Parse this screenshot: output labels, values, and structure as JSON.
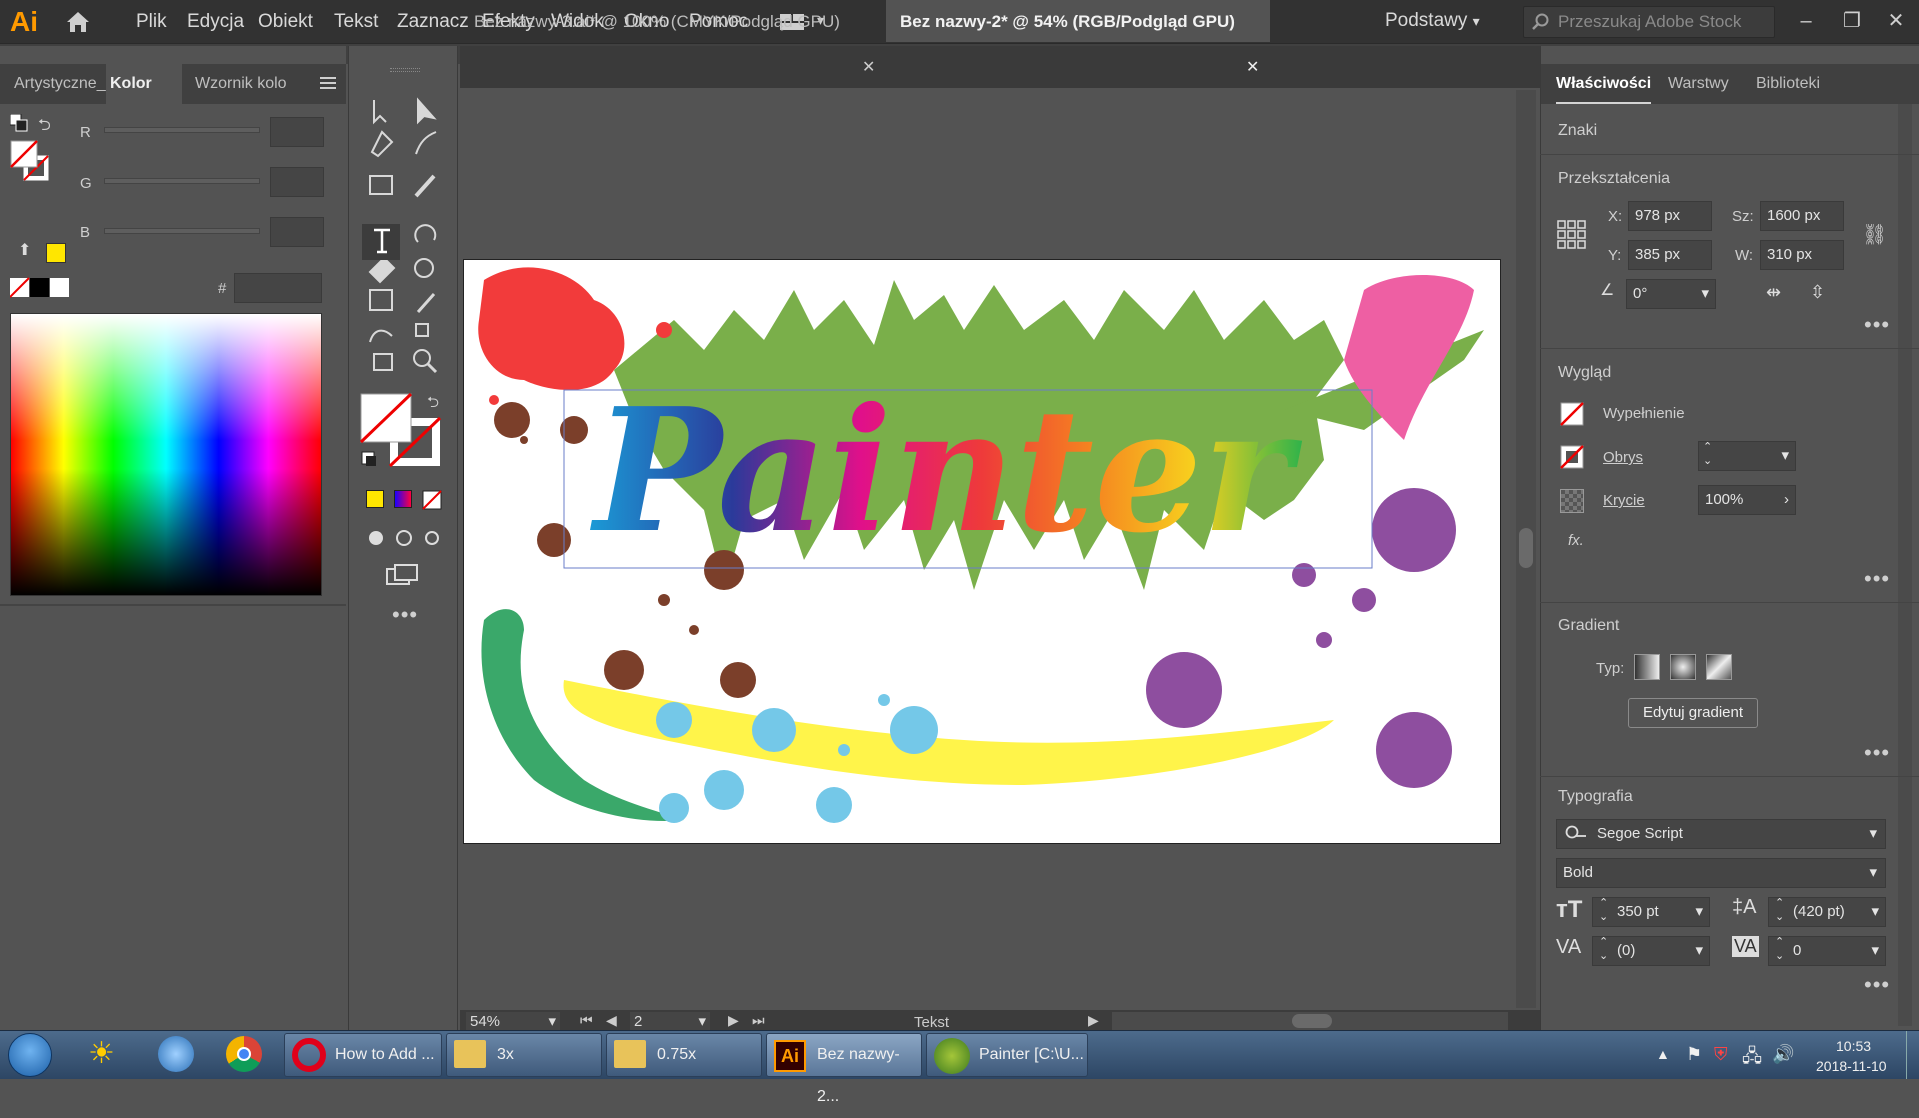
{
  "app": {
    "logo": "Ai"
  },
  "menu": [
    "Plik",
    "Edycja",
    "Obiekt",
    "Tekst",
    "Zaznacz",
    "Efekty",
    "Widok",
    "Okno",
    "Pomoc"
  ],
  "workspace": "Podstawy",
  "search_placeholder": "Przeszukaj Adobe Stock",
  "left_panel": {
    "tabs": [
      "Artystyczne_",
      "Kolor",
      "Wzornik kolo"
    ],
    "sliders": [
      "R",
      "G",
      "B"
    ],
    "hex_label": "#",
    "active_tab": "Kolor"
  },
  "doc_tabs": [
    {
      "label": "Bez nazwy-3.ai* @ 100% (CMYK/Podgląd GPU)",
      "active": false
    },
    {
      "label": "Bez nazwy-2* @ 54% (RGB/Podgląd GPU)",
      "active": true
    }
  ],
  "artboard": {
    "title_text": "Painter"
  },
  "status": {
    "zoom": "54%",
    "artboard_num": "2",
    "mode": "Tekst"
  },
  "right_panel": {
    "tabs": [
      "Właściwości",
      "Warstwy",
      "Biblioteki"
    ],
    "znaki": "Znaki",
    "transform": {
      "title": "Przekształcenia",
      "x_label": "X:",
      "x": "978 px",
      "y_label": "Y:",
      "y": "385 px",
      "w_label": "Sz:",
      "w": "1600 px",
      "h_label": "W:",
      "h": "310 px",
      "angle": "0°"
    },
    "appearance": {
      "title": "Wygląd",
      "fill": "Wypełnienie",
      "stroke": "Obrys",
      "opacity_label": "Krycie",
      "opacity": "100%",
      "fx": "fx."
    },
    "gradient": {
      "title": "Gradient",
      "type_label": "Typ:",
      "edit_button": "Edytuj gradient"
    },
    "typography": {
      "title": "Typografia",
      "font": "Segoe Script",
      "style": "Bold",
      "size": "350 pt",
      "leading": "(420 pt)",
      "kerning": "(0)",
      "tracking": "0"
    }
  },
  "taskbar": {
    "items": [
      {
        "label": "How to Add ..."
      },
      {
        "label": "3x"
      },
      {
        "label": "0.75x"
      },
      {
        "label": "Bez nazwy-2..."
      },
      {
        "label": "Painter [C:\\U..."
      }
    ],
    "time": "10:53",
    "date": "2018-11-10"
  },
  "colors": {
    "accent_fill": "#ff0000",
    "swatch_yellow": "#ffe600"
  }
}
